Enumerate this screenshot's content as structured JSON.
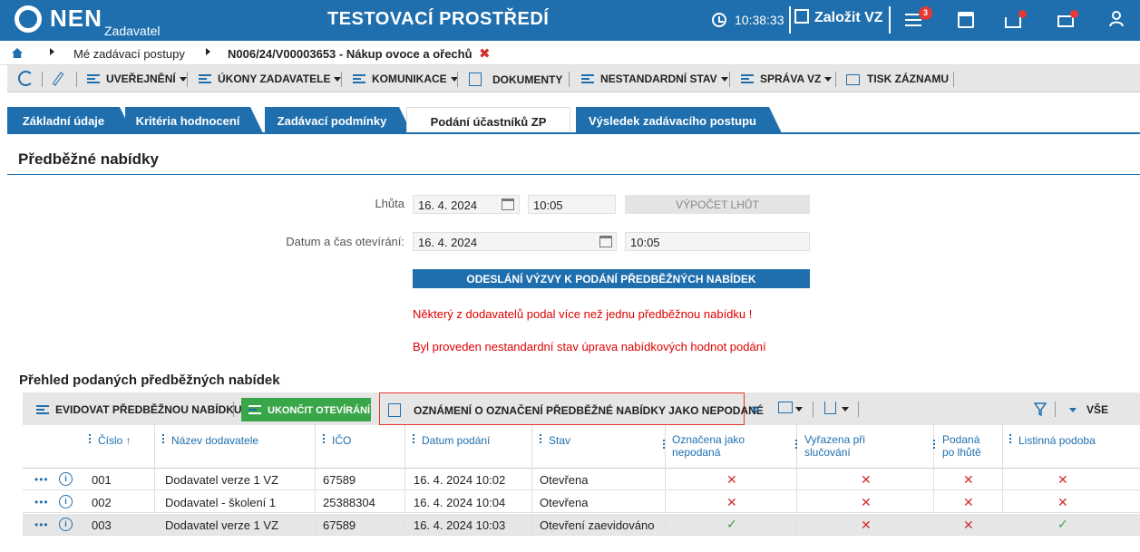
{
  "header": {
    "logo": "NEN",
    "logo_sub": "Zadavatel",
    "env_title": "TESTOVACÍ PROSTŘEDÍ",
    "clock": "10:38:33",
    "create_label": "Založit VZ",
    "menu_badge": "3"
  },
  "breadcrumb": {
    "item1": "Mé zadávací postupy",
    "item2": "N006/24/V00003653 - Nákup ovoce a ořechů",
    "close": "✖"
  },
  "toolbar": {
    "uverejneni": "UVEŘEJNĚNÍ",
    "ukony": "ÚKONY ZADAVATELE",
    "komunikace": "KOMUNIKACE",
    "dokumenty": "DOKUMENTY",
    "nestandardni": "NESTANDARDNÍ STAV",
    "sprava": "SPRÁVA VZ",
    "tisk": "TISK ZÁZNAMU"
  },
  "tabs": [
    {
      "label": "Základní údaje"
    },
    {
      "label": "Kritéria hodnocení"
    },
    {
      "label": "Zadávací podmínky"
    },
    {
      "label": "Podání účastníků ZP"
    },
    {
      "label": "Výsledek zadávacího postupu"
    }
  ],
  "section_title": "Předběžné nabídky",
  "form": {
    "lhuta_label": "Lhůta",
    "lhuta_date": "16. 4. 2024",
    "lhuta_time": "10:05",
    "vypocet_btn": "VÝPOČET LHŮT",
    "otevirani_label": "Datum a čas otevírání:",
    "otevirani_date": "16. 4. 2024",
    "otevirani_time": "10:05",
    "odeslani_btn": "ODESLÁNÍ VÝZVY K PODÁNÍ PŘEDBĚŽNÝCH NABÍDEK",
    "warning1": "Některý z dodavatelů podal více než jednu předběžnou nabídku !",
    "warning2": "Byl proveden nestandardní stav úprava nabídkových hodnot podání"
  },
  "grid": {
    "title": "Přehled podaných předběžných nabídek",
    "evidovat": "EVIDOVAT PŘEDBĚŽNOU NABÍDKU",
    "ukoncit": "UKONČIT OTEVÍRÁNÍ",
    "oznameni": "OZNÁMENÍ O OZNAČENÍ PŘEDBĚŽNÉ NABÍDKY JAKO NEPODANÉ",
    "more": "»",
    "filter_all": "VŠE",
    "columns": {
      "cislo": "Číslo ↑",
      "nazev": "Název dodavatele",
      "ico": "IČO",
      "datum": "Datum podání",
      "stav": "Stav",
      "oznacena1": "Označena jako",
      "oznacena2": "nepodaná",
      "vyrazena1": "Vyřazena při",
      "vyrazena2": "slučování",
      "podana1": "Podaná",
      "podana2": "po lhůtě",
      "listinna": "Listinná podoba"
    },
    "rows": [
      {
        "dots": "•••",
        "info": "i",
        "cislo": "001",
        "nazev": "Dodavatel verze 1 VZ",
        "ico": "67589",
        "datum": "16. 4. 2024 10:02",
        "stav": "Otevřena",
        "oznacena": "✕",
        "vyrazena": "✕",
        "podana": "✕",
        "listinna": "✕"
      },
      {
        "dots": "•••",
        "info": "i",
        "cislo": "002",
        "nazev": "Dodavatel - školení 1",
        "ico": "25388304",
        "datum": "16. 4. 2024 10:04",
        "stav": "Otevřena",
        "oznacena": "✕",
        "vyrazena": "✕",
        "podana": "✕",
        "listinna": "✕"
      },
      {
        "dots": "•••",
        "info": "i",
        "cislo": "003",
        "nazev": "Dodavatel verze 1 VZ",
        "ico": "67589",
        "datum": "16. 4. 2024 10:03",
        "stav": "Otevření zaevidováno",
        "oznacena": "✓",
        "vyrazena": "✕",
        "podana": "✕",
        "listinna": "✓"
      }
    ]
  },
  "colors": {
    "brand": "#1f6fae",
    "warning": "#e00000",
    "success": "#3aa64a"
  }
}
